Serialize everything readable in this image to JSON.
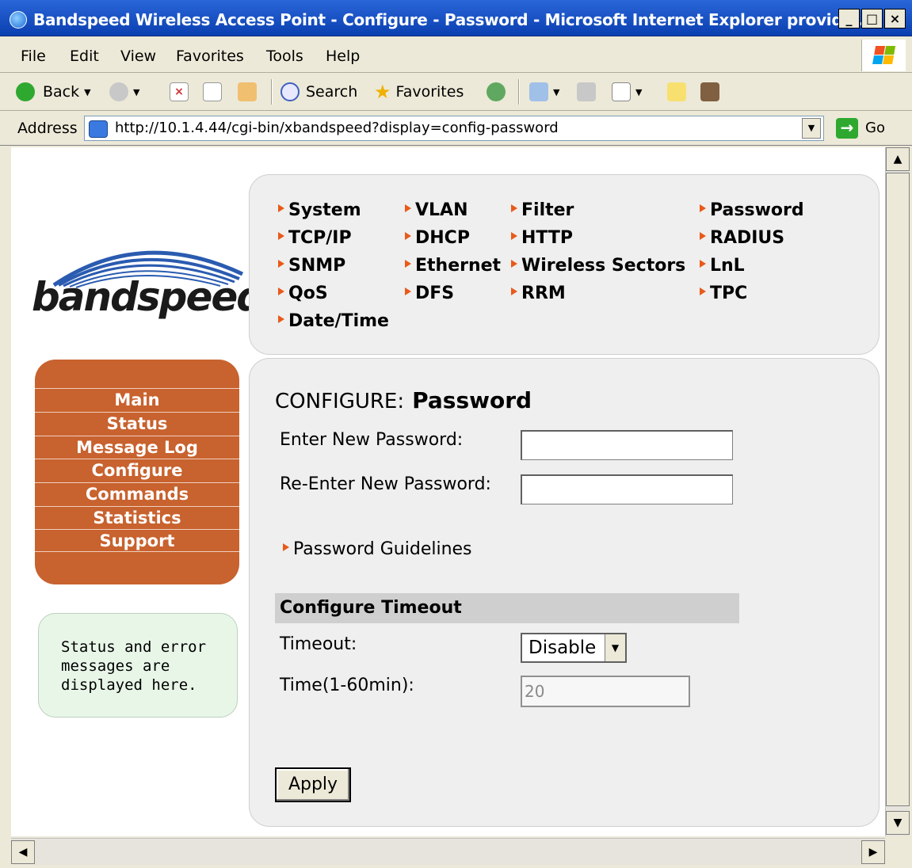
{
  "window": {
    "title": "Bandspeed Wireless Access Point - Configure - Password - Microsoft Internet Explorer provide...",
    "min_label": "_",
    "max_label": "□",
    "close_label": "×"
  },
  "menubar": [
    "File",
    "Edit",
    "View",
    "Favorites",
    "Tools",
    "Help"
  ],
  "toolbar": {
    "back": "Back",
    "search": "Search",
    "favorites": "Favorites"
  },
  "address": {
    "label": "Address",
    "url": "http://10.1.4.44/cgi-bin/xbandspeed?display=config-password",
    "go": "Go"
  },
  "logo": {
    "text": "bandspeed"
  },
  "nav": [
    [
      "System",
      "VLAN",
      "Filter",
      "Password"
    ],
    [
      "TCP/IP",
      "DHCP",
      "HTTP",
      "RADIUS"
    ],
    [
      "SNMP",
      "Ethernet",
      "Wireless Sectors",
      "LnL"
    ],
    [
      "QoS",
      "DFS",
      "RRM",
      "TPC"
    ],
    [
      "Date/Time"
    ]
  ],
  "left_menu": [
    "Main",
    "Status",
    "Message Log",
    "Configure",
    "Commands",
    "Statistics",
    "Support"
  ],
  "status_box": {
    "message": "Status and error messages are displayed here."
  },
  "page": {
    "title_prefix": "CONFIGURE:",
    "title": "Password",
    "new_password_label": "Enter New Password:",
    "new_password_value": "",
    "reenter_password_label": "Re-Enter New Password:",
    "reenter_password_value": "",
    "guidelines_link": "Password Guidelines",
    "section_title": "Configure Timeout",
    "timeout_label": "Timeout:",
    "timeout_value": "Disable",
    "time_label": "Time(1-60min):",
    "time_value": "20",
    "apply_label": "Apply"
  },
  "colors": {
    "accent_orange": "#c8622e",
    "nav_arrow": "#e85a1a",
    "panel_bg": "#efefef",
    "status_bg": "#e8f6e8"
  }
}
